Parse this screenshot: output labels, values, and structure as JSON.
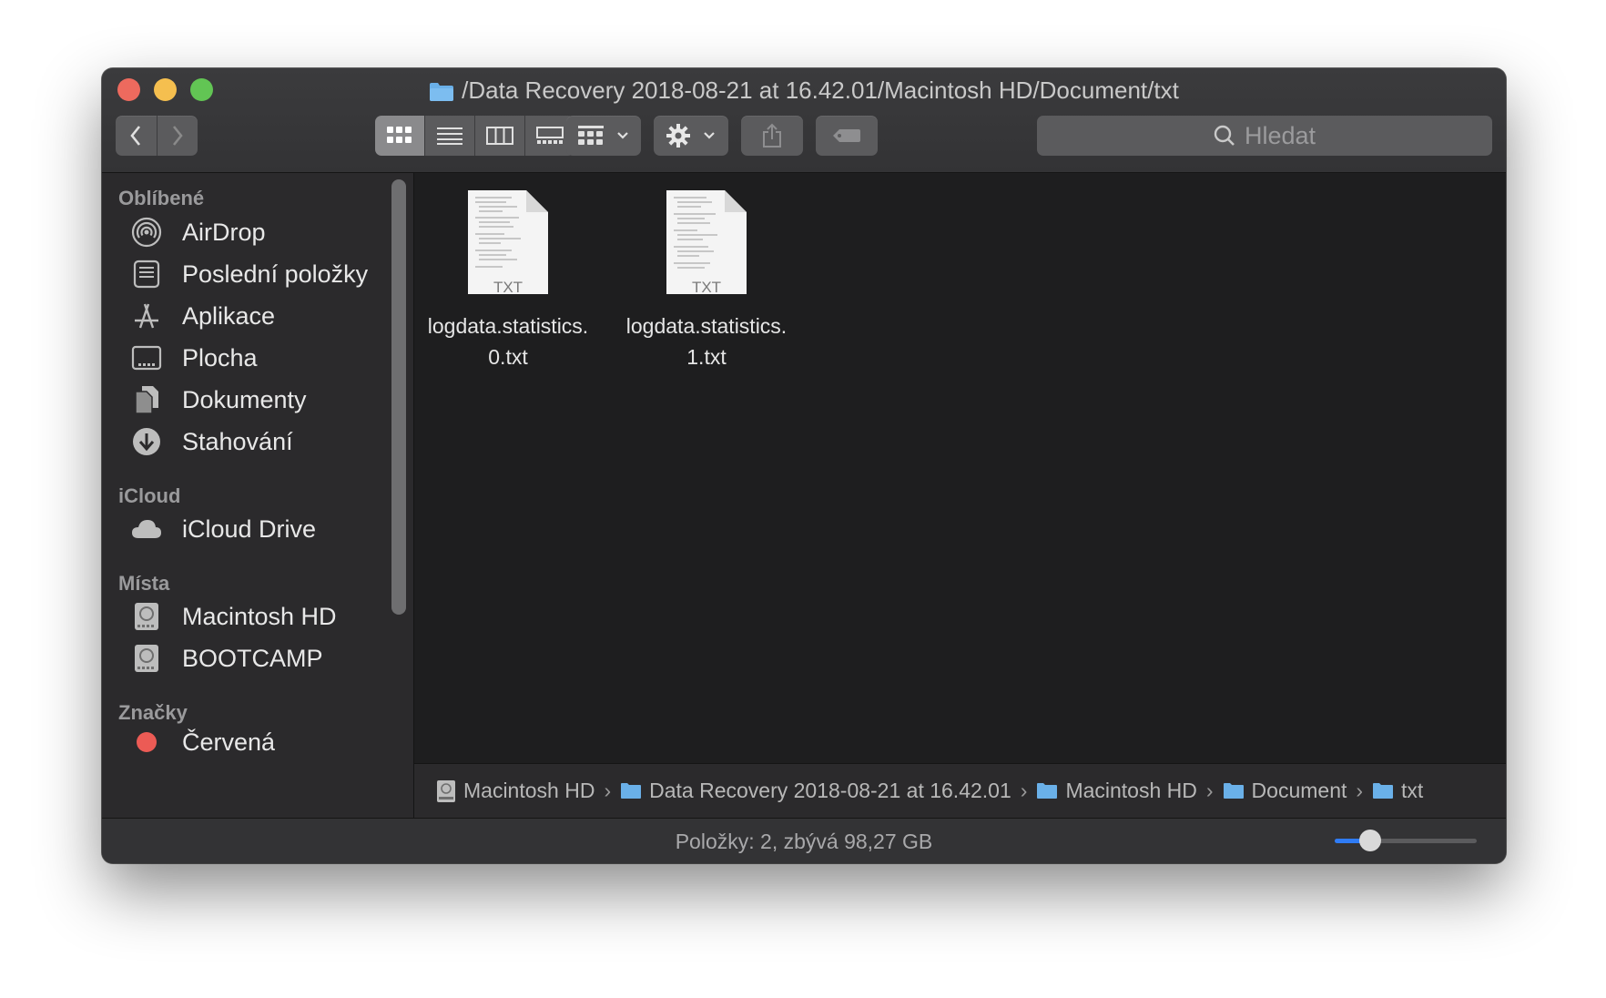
{
  "window": {
    "title": "/Data Recovery 2018-08-21 at 16.42.01/Macintosh HD/Document/txt"
  },
  "toolbar": {
    "search_placeholder": "Hledat",
    "active_view": "icon"
  },
  "sidebar": {
    "sections": [
      {
        "title": "Oblíbené",
        "items": [
          {
            "label": "AirDrop",
            "icon": "airdrop-icon"
          },
          {
            "label": "Poslední položky",
            "icon": "recents-icon"
          },
          {
            "label": "Aplikace",
            "icon": "applications-icon"
          },
          {
            "label": "Plocha",
            "icon": "desktop-icon"
          },
          {
            "label": "Dokumenty",
            "icon": "documents-icon"
          },
          {
            "label": "Stahování",
            "icon": "downloads-icon"
          }
        ]
      },
      {
        "title": "iCloud",
        "items": [
          {
            "label": "iCloud Drive",
            "icon": "cloud-icon"
          }
        ]
      },
      {
        "title": "Místa",
        "items": [
          {
            "label": "Macintosh HD",
            "icon": "disk-icon"
          },
          {
            "label": "BOOTCAMP",
            "icon": "disk-icon"
          }
        ]
      },
      {
        "title": "Značky",
        "items": [
          {
            "label": "Červená",
            "icon": "red-tag-icon",
            "color": "#ec5b55"
          }
        ]
      }
    ]
  },
  "files": [
    {
      "name_line1": "logdata.statistics.",
      "name_line2": "0.txt",
      "badge": "TXT"
    },
    {
      "name_line1": "logdata.statistics.",
      "name_line2": "1.txt",
      "badge": "TXT"
    }
  ],
  "path": [
    "Macintosh HD",
    "Data Recovery 2018-08-21 at 16.42.01",
    "Macintosh HD",
    "Document",
    "txt"
  ],
  "status": {
    "text": "Položky: 2, zbývá 98,27 GB",
    "icon_size_level": 0.25
  },
  "colors": {
    "accent": "#2f7cf6",
    "folder": "#6ab0e8"
  }
}
